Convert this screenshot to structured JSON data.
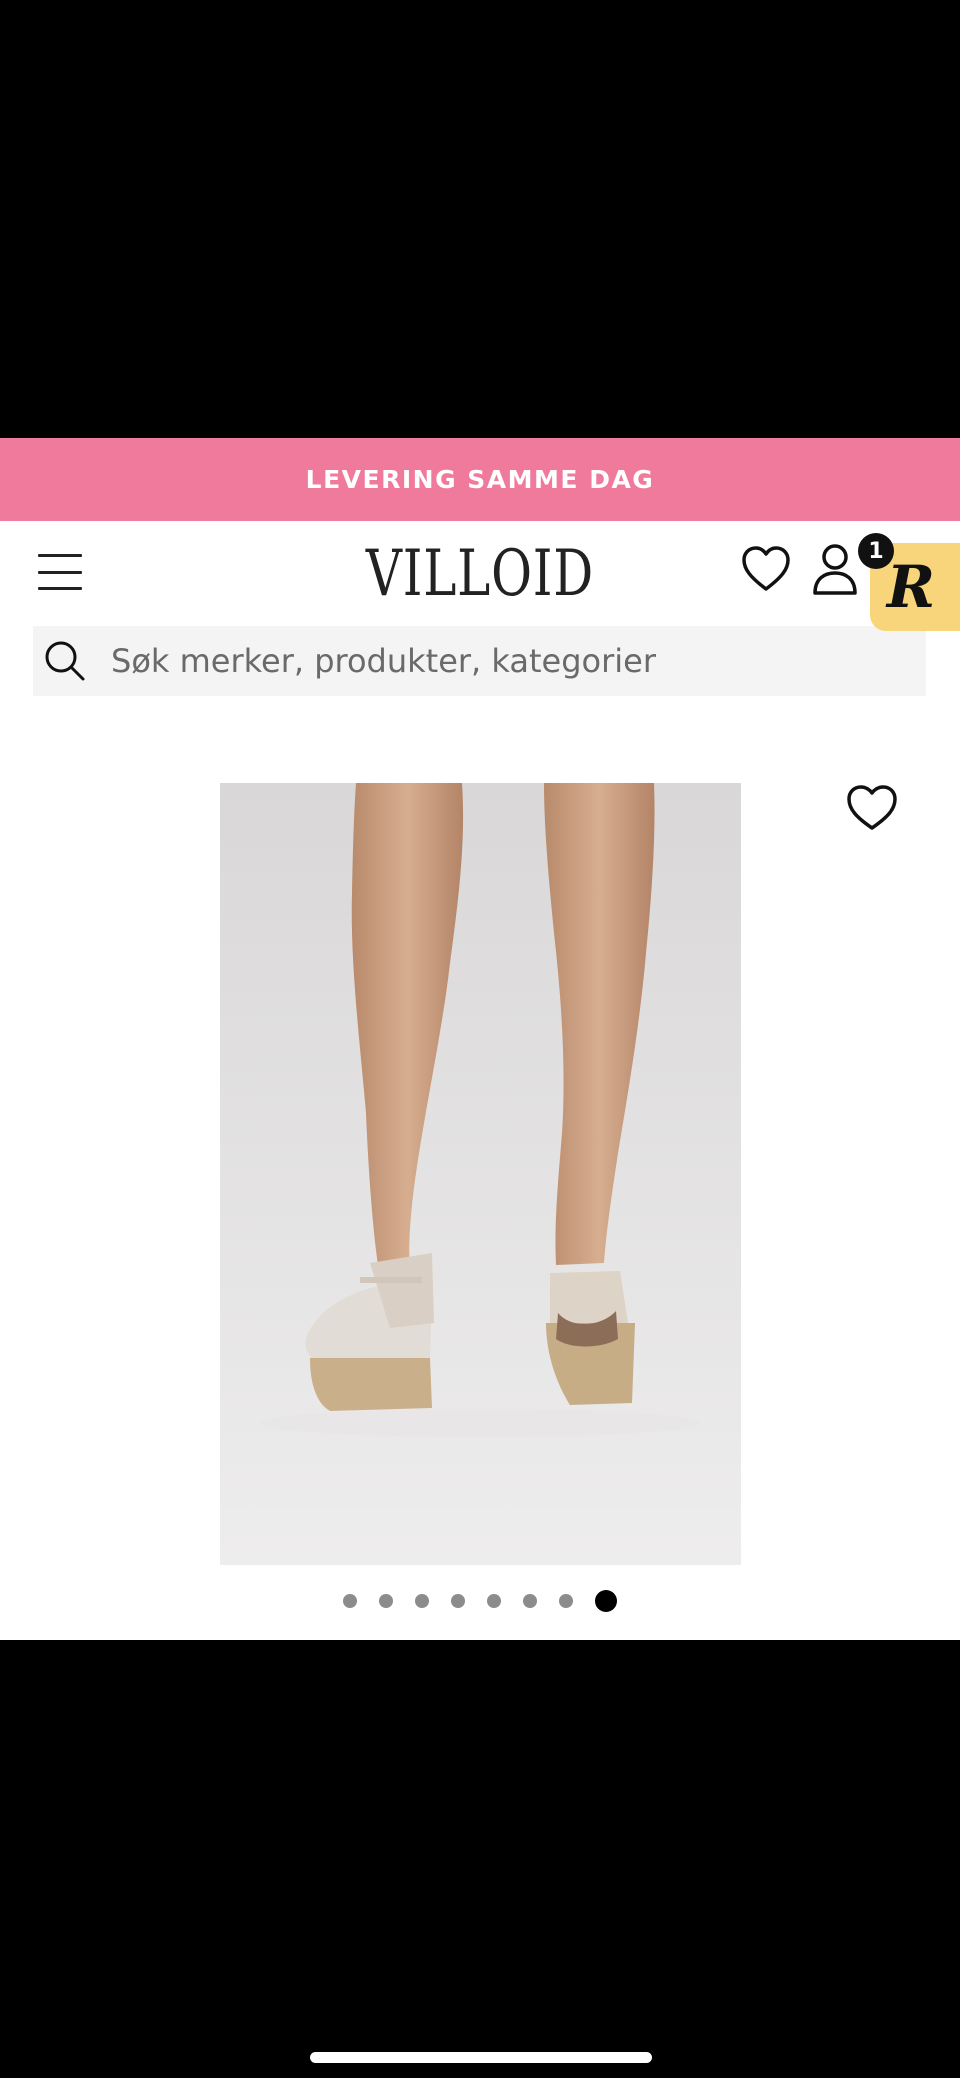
{
  "banner": {
    "text": "LEVERING SAMME DAG",
    "color": "#f07a9c"
  },
  "header": {
    "logo": "VILLOID",
    "cart_count": "1",
    "r_badge_letter": "R",
    "icons": [
      "menu-icon",
      "heart-icon",
      "user-icon"
    ]
  },
  "search": {
    "placeholder": "Søk merker, produkter, kategorier"
  },
  "gallery": {
    "total_slides": 8,
    "active_slide": 8,
    "image_alt": "Espadrille wedge sandals"
  }
}
